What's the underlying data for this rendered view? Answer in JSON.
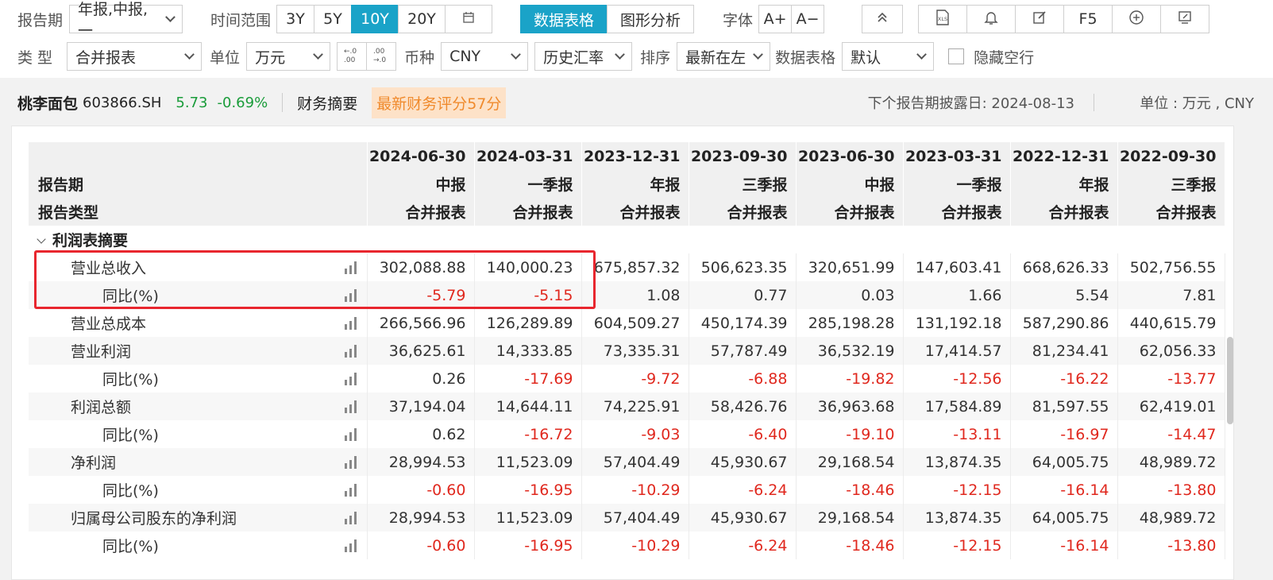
{
  "toolbar": {
    "report_period_label": "报告期",
    "report_period_value": "年报,中报,一",
    "time_range_label": "时间范围",
    "time_ranges": [
      "3Y",
      "5Y",
      "10Y",
      "20Y"
    ],
    "active_time_range": "10Y",
    "view_tabs": [
      "数据表格",
      "图形分析"
    ],
    "active_view": "数据表格",
    "font_label": "字体",
    "font_up": "A+",
    "font_down": "A−",
    "f5_label": "F5",
    "type_label": "类  型",
    "type_value": "合并报表",
    "unit_label": "单位",
    "unit_value": "万元",
    "currency_label": "币种",
    "currency_value": "CNY",
    "rate_value": "历史汇率",
    "sort_label": "排序",
    "sort_value": "最新在左",
    "table_label": "数据表格",
    "table_value": "默认",
    "hide_empty_label": "隐藏空行"
  },
  "stock": {
    "name": "桃李面包",
    "code": "603866.SH",
    "price": "5.73",
    "change": "-0.69%",
    "section": "财务摘要",
    "score": "最新财务评分57分",
    "next_date": "下个报告期披露日: 2024-08-13",
    "unit": "单位 : 万元 , CNY"
  },
  "table": {
    "header_label_period": "报告期",
    "header_label_type": "报告类型",
    "dates": [
      "2024-06-30",
      "2024-03-31",
      "2023-12-31",
      "2023-09-30",
      "2023-06-30",
      "2023-03-31",
      "2022-12-31",
      "2022-09-30"
    ],
    "periods": [
      "中报",
      "一季报",
      "年报",
      "三季报",
      "中报",
      "一季报",
      "年报",
      "三季报"
    ],
    "types": [
      "合并报表",
      "合并报表",
      "合并报表",
      "合并报表",
      "合并报表",
      "合并报表",
      "合并报表",
      "合并报表"
    ],
    "section": "利润表摘要",
    "rows": [
      {
        "label": "营业总收入",
        "level": 1,
        "values": [
          "302,088.88",
          "140,000.23",
          "675,857.32",
          "506,623.35",
          "320,651.99",
          "147,603.41",
          "668,626.33",
          "502,756.55"
        ]
      },
      {
        "label": "同比(%)",
        "level": 2,
        "values": [
          "-5.79",
          "-5.15",
          "1.08",
          "0.77",
          "0.03",
          "1.66",
          "5.54",
          "7.81"
        ]
      },
      {
        "label": "营业总成本",
        "level": 1,
        "values": [
          "266,566.96",
          "126,289.89",
          "604,509.27",
          "450,174.39",
          "285,198.28",
          "131,192.18",
          "587,290.86",
          "440,615.79"
        ]
      },
      {
        "label": "营业利润",
        "level": 1,
        "values": [
          "36,625.61",
          "14,333.85",
          "73,335.31",
          "57,787.49",
          "36,532.19",
          "17,414.57",
          "81,234.41",
          "62,056.33"
        ]
      },
      {
        "label": "同比(%)",
        "level": 2,
        "values": [
          "0.26",
          "-17.69",
          "-9.72",
          "-6.88",
          "-19.82",
          "-12.56",
          "-16.22",
          "-13.77"
        ]
      },
      {
        "label": "利润总额",
        "level": 1,
        "values": [
          "37,194.04",
          "14,644.11",
          "74,225.91",
          "58,426.76",
          "36,963.68",
          "17,584.89",
          "81,597.55",
          "62,419.01"
        ]
      },
      {
        "label": "同比(%)",
        "level": 2,
        "values": [
          "0.62",
          "-16.72",
          "-9.03",
          "-6.40",
          "-19.10",
          "-13.11",
          "-16.97",
          "-14.47"
        ]
      },
      {
        "label": "净利润",
        "level": 1,
        "values": [
          "28,994.53",
          "11,523.09",
          "57,404.49",
          "45,930.67",
          "29,168.54",
          "13,874.35",
          "64,005.75",
          "48,989.72"
        ]
      },
      {
        "label": "同比(%)",
        "level": 2,
        "values": [
          "-0.60",
          "-16.95",
          "-10.29",
          "-6.24",
          "-18.46",
          "-12.15",
          "-16.14",
          "-13.80"
        ]
      },
      {
        "label": "归属母公司股东的净利润",
        "level": 1,
        "values": [
          "28,994.53",
          "11,523.09",
          "57,404.49",
          "45,930.67",
          "29,168.54",
          "13,874.35",
          "64,005.75",
          "48,989.72"
        ]
      },
      {
        "label": "同比(%)",
        "level": 2,
        "values": [
          "-0.60",
          "-16.95",
          "-10.29",
          "-6.24",
          "-18.46",
          "-12.15",
          "-16.14",
          "-13.80"
        ]
      }
    ]
  },
  "colors": {
    "accent": "#1aa3c8",
    "negative": "#e0281e",
    "positive_price": "#1a9c3a",
    "highlight": "#e8262e",
    "score_bg": "#fde2c8",
    "score_text": "#f08a2c"
  }
}
